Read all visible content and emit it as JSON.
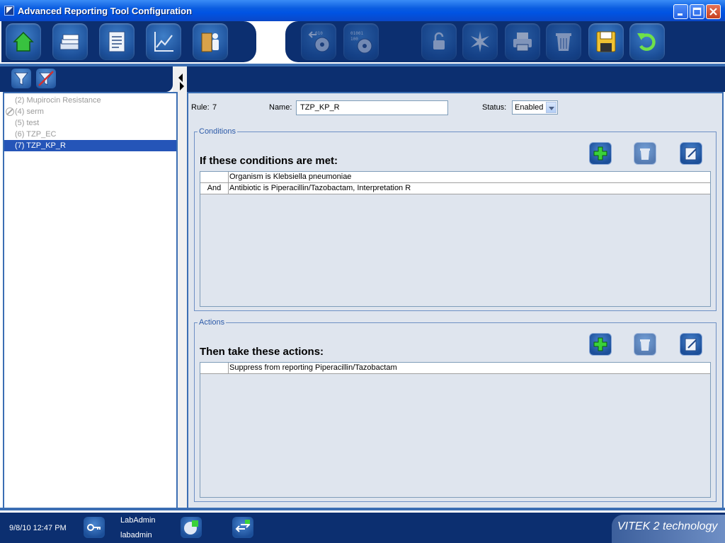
{
  "window": {
    "title": "Advanced Reporting Tool Configuration"
  },
  "toolbar": {
    "left_icons": [
      "home-icon",
      "cards-icon",
      "clipboard-icon",
      "trend-chart-icon",
      "user-door-icon"
    ],
    "right_icons": [
      "import-disk-icon",
      "export-disk-icon",
      "unlock-icon",
      "starburst-icon",
      "printer-icon",
      "trash-icon",
      "save-disk-icon",
      "undo-icon"
    ]
  },
  "rules": [
    {
      "label": "(2) Mupirocin Resistance",
      "disabled": false,
      "selected": false
    },
    {
      "label": "(4) serm",
      "disabled": true,
      "selected": false
    },
    {
      "label": "(5) test",
      "disabled": false,
      "selected": false
    },
    {
      "label": "(6) TZP_EC",
      "disabled": false,
      "selected": false
    },
    {
      "label": "(7) TZP_KP_R",
      "disabled": false,
      "selected": true
    }
  ],
  "detail": {
    "rule_label": "Rule:",
    "rule_number": "7",
    "name_label": "Name:",
    "name_value": "TZP_KP_R",
    "status_label": "Status:",
    "status_value": "Enabled"
  },
  "conditions": {
    "legend": "Conditions",
    "title": "If these conditions are met:",
    "rows": [
      {
        "joiner": "",
        "text": "Organism is Klebsiella pneumoniae"
      },
      {
        "joiner": "And",
        "text": "Antibiotic is Piperacillin/Tazobactam, Interpretation R"
      }
    ]
  },
  "actions": {
    "legend": "Actions",
    "title": "Then take these actions:",
    "rows": [
      {
        "joiner": "",
        "text": "Suppress from reporting Piperacillin/Tazobactam"
      }
    ]
  },
  "statusbar": {
    "datetime": "9/8/10 12:47 PM",
    "user_display": "LabAdmin",
    "user_login": "labadmin",
    "brand": "VITEK 2 technology"
  }
}
